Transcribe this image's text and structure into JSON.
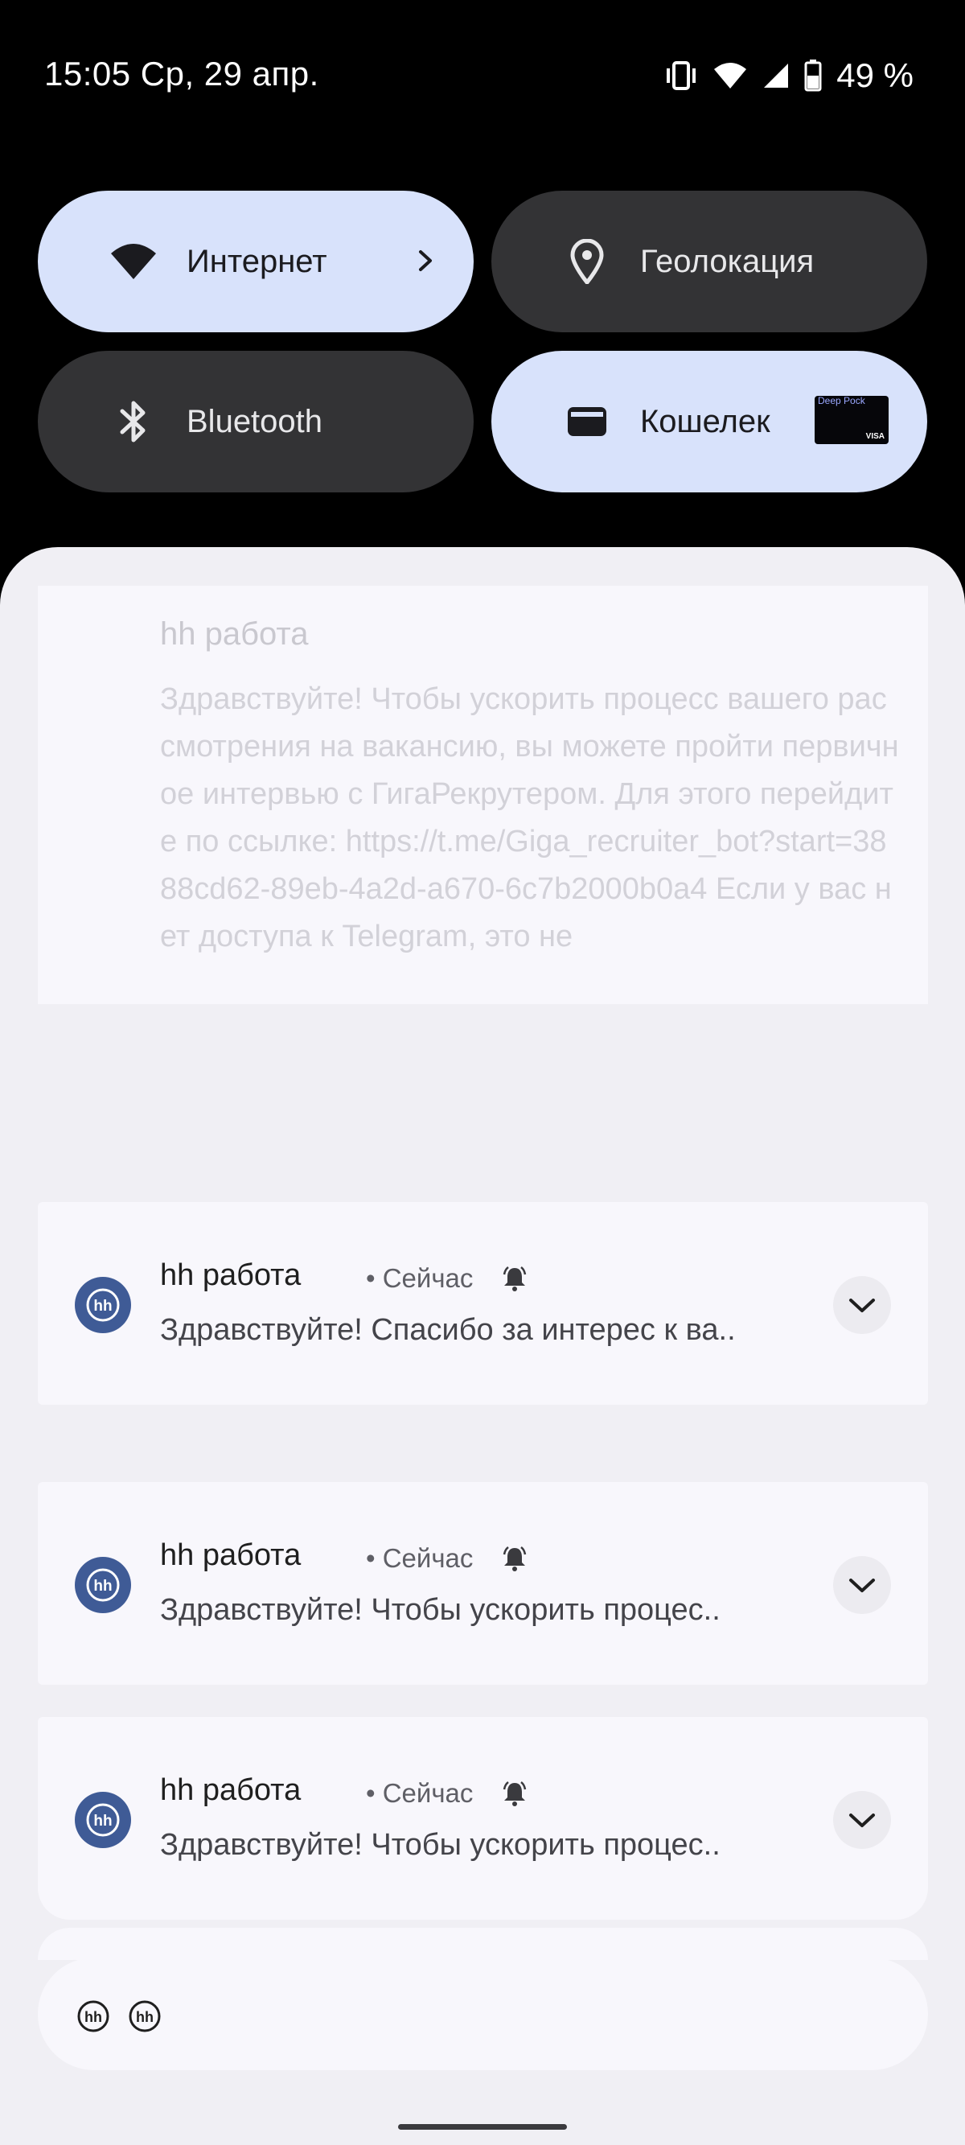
{
  "status_bar": {
    "time_date": "15:05 Ср, 29 апр.",
    "battery_percent": "49 %",
    "icons": [
      "vibrate-icon",
      "wifi-icon",
      "cell-signal-icon",
      "battery-icon"
    ]
  },
  "quick_tiles": [
    {
      "label": "Интернет",
      "state": "on",
      "icon": "wifi-icon"
    },
    {
      "label": "Геолокация",
      "state": "off",
      "icon": "location-pin-icon"
    },
    {
      "label": "Bluetooth",
      "state": "off",
      "icon": "bluetooth-icon"
    },
    {
      "label": "Кошелек",
      "state": "on",
      "icon": "wallet-icon"
    }
  ],
  "wallet_card": {
    "art_text": "Deep Pock",
    "brand": "VISA"
  },
  "expanded_notification": {
    "app": "hh работа",
    "text": "Здравствуйте! Чтобы ускорить процесс вашего рассмотрения на вакансию, вы можете пройти первичное интервью с ГигаРекрутером. Для этого перейдите по ссылке: https://t.me/Giga_recruiter_bot?start=3888cd62-89eb-4a2d-a670-6c7b2000b0a4 Если у вас нет доступа к Telegram, это не"
  },
  "notifications": [
    {
      "app": "hh работа",
      "time": "• Сейчас",
      "text": "Здравствуйте! Спасибо за интерес к ва.."
    },
    {
      "app": "hh работа",
      "time": "• Сейчас",
      "text": "Здравствуйте! Чтобы ускорить процес.."
    },
    {
      "app": "hh работа",
      "time": "• Сейчас",
      "text": "Здравствуйте! Чтобы ускорить процес.."
    }
  ],
  "summary_icons": [
    "hh-icon",
    "hh-icon"
  ],
  "colors": {
    "tile_on": "#d8e2fb",
    "tile_off": "#333335",
    "shade_bg": "#f0eff4",
    "card_bg": "#f8f7fc",
    "avatar": "#3f5b96"
  }
}
